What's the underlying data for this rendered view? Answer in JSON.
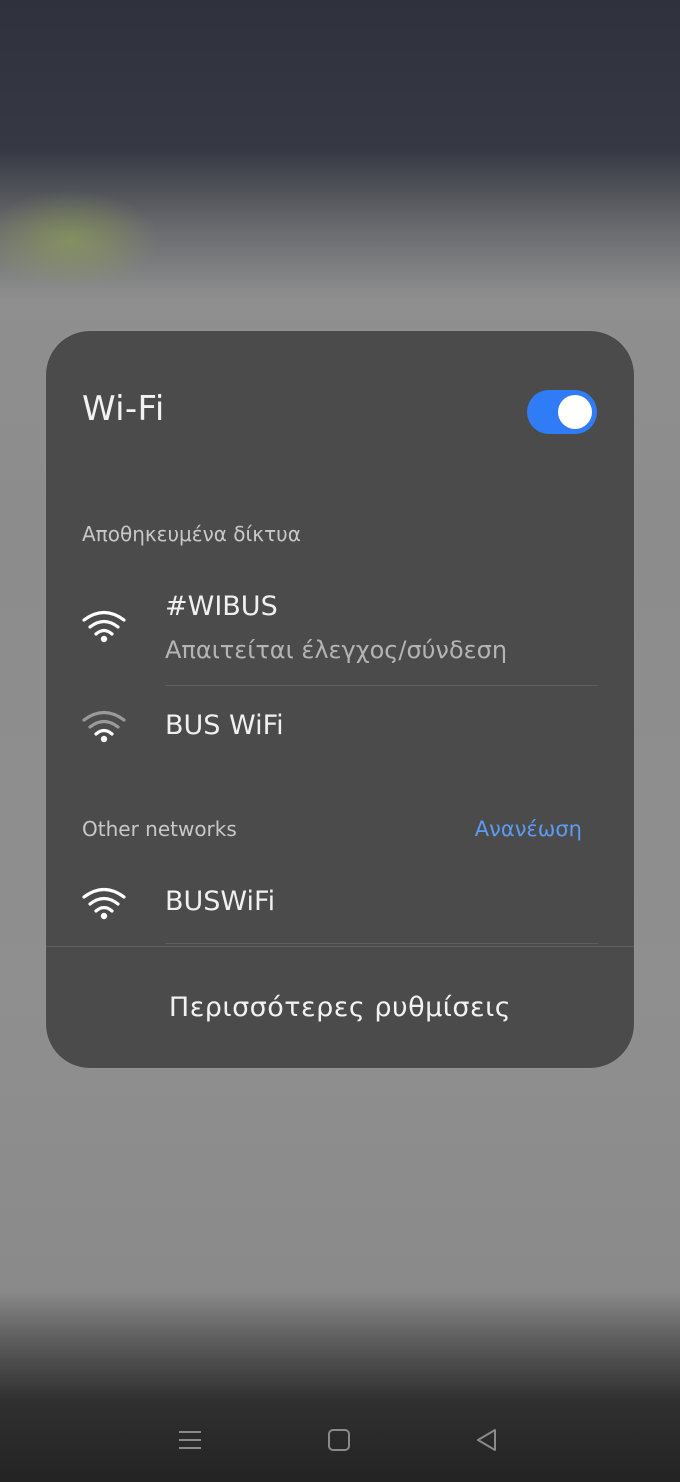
{
  "panel": {
    "title": "Wi-Fi",
    "toggle_on": true,
    "accent_color": "#2f7cf6"
  },
  "saved_networks": {
    "label": "Αποθηκευμένα δίκτυα",
    "items": [
      {
        "name": "#WIBUS",
        "status": "Απαιτείται έλεγχος/σύνδεση",
        "icon": "wifi-icon"
      },
      {
        "name": "BUS WiFi",
        "status": "",
        "icon": "wifi-icon"
      }
    ]
  },
  "other_networks": {
    "label": "Other networks",
    "refresh_label": "Ανανέωση",
    "refresh_color": "#5b9bf2",
    "items": [
      {
        "name": "BUSWiFi",
        "icon": "wifi-icon"
      }
    ]
  },
  "footer": {
    "more_settings_label": "Περισσότερες ρυθμίσεις"
  },
  "navigation": {
    "buttons": [
      "menu-icon",
      "home-square-icon",
      "back-triangle-icon"
    ]
  }
}
